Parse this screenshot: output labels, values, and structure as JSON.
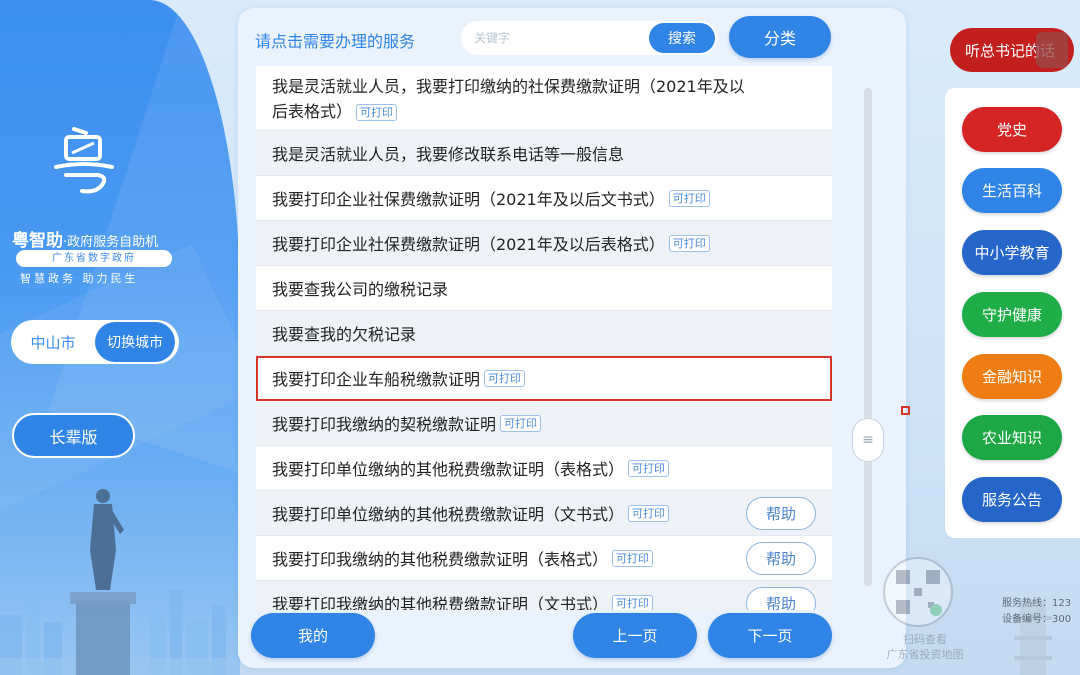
{
  "left": {
    "brand_name": "粤智助",
    "brand_sub": "·政府服务自助机",
    "brand_tag": "广东省数字政府",
    "slogan": "智慧政务  助力民生",
    "city": "中山市",
    "switch_city": "切换城市",
    "elder_mode": "长辈版"
  },
  "header": {
    "prompt": "请点击需要办理的服务",
    "search_placeholder": "关键字",
    "search_label": "搜索",
    "category_label": "分类"
  },
  "services": [
    {
      "line1": "我是灵活就业人员，我要打印缴纳的社保费缴款证明（2021年及以",
      "line2": "后表格式）",
      "tag": "可打印"
    },
    {
      "text": "我是灵活就业人员，我要修改联系电话等一般信息"
    },
    {
      "text": "我要打印企业社保费缴款证明（2021年及以后文书式）",
      "tag": "可打印"
    },
    {
      "text": "我要打印企业社保费缴款证明（2021年及以后表格式）",
      "tag": "可打印"
    },
    {
      "text": "我要查我公司的缴税记录"
    },
    {
      "text": "我要查我的欠税记录"
    },
    {
      "text": "我要打印企业车船税缴款证明",
      "tag": "可打印"
    },
    {
      "text": "我要打印我缴纳的契税缴款证明",
      "tag": "可打印"
    },
    {
      "text": "我要打印单位缴纳的其他税费缴款证明（表格式）",
      "tag": "可打印"
    },
    {
      "text": "我要打印单位缴纳的其他税费缴款证明（文书式）",
      "tag": "可打印",
      "help": "帮助"
    },
    {
      "text": "我要打印我缴纳的其他税费缴款证明（表格式）",
      "tag": "可打印",
      "help": "帮助"
    },
    {
      "text": "我要打印我缴纳的其他税费缴款证明（文书式）",
      "tag": "可打印",
      "help": "帮助"
    }
  ],
  "footer": {
    "mine": "我的",
    "prev": "上一页",
    "next": "下一页"
  },
  "right": {
    "top_button": "听总书记的话",
    "buttons": [
      {
        "label": "党史",
        "color": "#d42424"
      },
      {
        "label": "生活百科",
        "color": "#2f84e6"
      },
      {
        "label": "中小学教育",
        "color": "#2566c8"
      },
      {
        "label": "守护健康",
        "color": "#1fad48"
      },
      {
        "label": "金融知识",
        "color": "#f07d14"
      },
      {
        "label": "农业知识",
        "color": "#1ea845"
      },
      {
        "label": "服务公告",
        "color": "#2566c8"
      }
    ],
    "qr_caption_1": "扫码查看",
    "qr_caption_2": "广东省投资地图",
    "hotline_label": "服务热线：",
    "hotline_value": "123",
    "device_label": "设备编号：",
    "device_value": "300"
  }
}
